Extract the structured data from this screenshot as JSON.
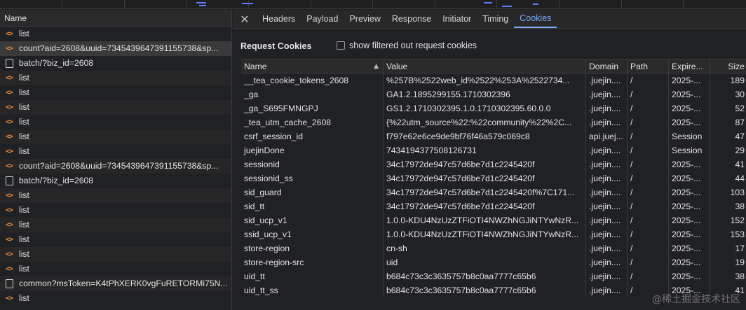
{
  "left": {
    "header": "Name",
    "requests": [
      {
        "type": "xhr",
        "name": "list"
      },
      {
        "type": "xhr",
        "name": "count?aid=2608&uuid=7345439647391155738&sp..."
      },
      {
        "type": "doc",
        "name": "batch/?biz_id=2608"
      },
      {
        "type": "xhr",
        "name": "list"
      },
      {
        "type": "xhr",
        "name": "list"
      },
      {
        "type": "xhr",
        "name": "list"
      },
      {
        "type": "xhr",
        "name": "list"
      },
      {
        "type": "xhr",
        "name": "list"
      },
      {
        "type": "xhr",
        "name": "list"
      },
      {
        "type": "xhr",
        "name": "count?aid=2608&uuid=7345439647391155738&sp..."
      },
      {
        "type": "doc",
        "name": "batch/?biz_id=2608"
      },
      {
        "type": "xhr",
        "name": "list"
      },
      {
        "type": "xhr",
        "name": "list"
      },
      {
        "type": "xhr",
        "name": "list"
      },
      {
        "type": "xhr",
        "name": "list"
      },
      {
        "type": "xhr",
        "name": "list"
      },
      {
        "type": "xhr",
        "name": "list"
      },
      {
        "type": "doc",
        "name": "common?msToken=K4tPhXERK0vgFuRETORMi75N..."
      },
      {
        "type": "xhr",
        "name": "list"
      }
    ]
  },
  "tabs": [
    "Headers",
    "Payload",
    "Preview",
    "Response",
    "Initiator",
    "Timing",
    "Cookies"
  ],
  "active_tab": "Cookies",
  "cookies": {
    "title": "Request Cookies",
    "filter_label": "show filtered out request cookies",
    "columns": {
      "name": "Name",
      "value": "Value",
      "domain": "Domain",
      "path": "Path",
      "expires": "Expire...",
      "size": "Size"
    },
    "rows": [
      {
        "name": "__tea_cookie_tokens_2608",
        "value": "%257B%2522web_id%2522%253A%2522734...",
        "domain": ".juejin....",
        "path": "/",
        "expires": "2025-...",
        "size": "189"
      },
      {
        "name": "_ga",
        "value": "GA1.2.1895299155.1710302396",
        "domain": ".juejin....",
        "path": "/",
        "expires": "2025-...",
        "size": "30"
      },
      {
        "name": "_ga_S695FMNGPJ",
        "value": "GS1.2.1710302395.1.0.1710302395.60.0.0",
        "domain": ".juejin....",
        "path": "/",
        "expires": "2025-...",
        "size": "52"
      },
      {
        "name": "_tea_utm_cache_2608",
        "value": "{%22utm_source%22:%22community%22%2C...",
        "domain": ".juejin....",
        "path": "/",
        "expires": "2025-...",
        "size": "87"
      },
      {
        "name": "csrf_session_id",
        "value": "f797e62e6ce9de9bf76f46a579c069c8",
        "domain": "api.juej...",
        "path": "/",
        "expires": "Session",
        "size": "47"
      },
      {
        "name": "juejinDone",
        "value": "7434194377508126731",
        "domain": ".juejin....",
        "path": "/",
        "expires": "Session",
        "size": "29"
      },
      {
        "name": "sessionid",
        "value": "34c17972de947c57d6be7d1c2245420f",
        "domain": ".juejin....",
        "path": "/",
        "expires": "2025-...",
        "size": "41"
      },
      {
        "name": "sessionid_ss",
        "value": "34c17972de947c57d6be7d1c2245420f",
        "domain": ".juejin....",
        "path": "/",
        "expires": "2025-...",
        "size": "44"
      },
      {
        "name": "sid_guard",
        "value": "34c17972de947c57d6be7d1c2245420f%7C171...",
        "domain": ".juejin....",
        "path": "/",
        "expires": "2025-...",
        "size": "103"
      },
      {
        "name": "sid_tt",
        "value": "34c17972de947c57d6be7d1c2245420f",
        "domain": ".juejin....",
        "path": "/",
        "expires": "2025-...",
        "size": "38"
      },
      {
        "name": "sid_ucp_v1",
        "value": "1.0.0-KDU4NzUzZTFiOTI4NWZhNGJiNTYwNzR...",
        "domain": ".juejin....",
        "path": "/",
        "expires": "2025-...",
        "size": "152"
      },
      {
        "name": "ssid_ucp_v1",
        "value": "1.0.0-KDU4NzUzZTFiOTI4NWZhNGJiNTYwNzR...",
        "domain": ".juejin....",
        "path": "/",
        "expires": "2025-...",
        "size": "153"
      },
      {
        "name": "store-region",
        "value": "cn-sh",
        "domain": ".juejin....",
        "path": "/",
        "expires": "2025-...",
        "size": "17"
      },
      {
        "name": "store-region-src",
        "value": "uid",
        "domain": ".juejin....",
        "path": "/",
        "expires": "2025-...",
        "size": "19"
      },
      {
        "name": "uid_tt",
        "value": "b684c73c3c3635757b8c0aa7777c65b6",
        "domain": ".juejin....",
        "path": "/",
        "expires": "2025-...",
        "size": "38"
      },
      {
        "name": "uid_tt_ss",
        "value": "b684c73c3c3635757b8c0aa7777c65b6",
        "domain": ".juejin....",
        "path": "/",
        "expires": "2025-...",
        "size": "41"
      }
    ]
  },
  "watermark": "@稀土掘金技术社区",
  "colors": {
    "accent": "#7cacf8",
    "xhr_icon": "#ee8a3a",
    "background": "#202124"
  }
}
